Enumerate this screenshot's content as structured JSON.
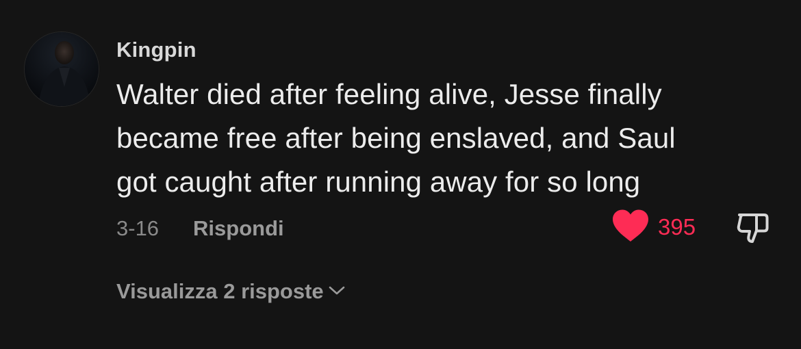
{
  "comment": {
    "username": "Kingpin",
    "text_lines": [
      "Walter died after feeling alive, Jesse finally",
      "became free after being enslaved, and Saul",
      "got caught after running away for so long"
    ],
    "date": "3-16",
    "reply_label": "Rispondi",
    "like_count": "395",
    "view_replies_label": "Visualizza 2 risposte"
  },
  "icons": {
    "like": "heart-icon",
    "dislike": "thumbs-down-icon",
    "expand": "chevron-down-icon"
  },
  "colors": {
    "background": "#141414",
    "like": "#fe2c55",
    "text": "#ececec",
    "secondary_text": "#9a9a9a"
  }
}
